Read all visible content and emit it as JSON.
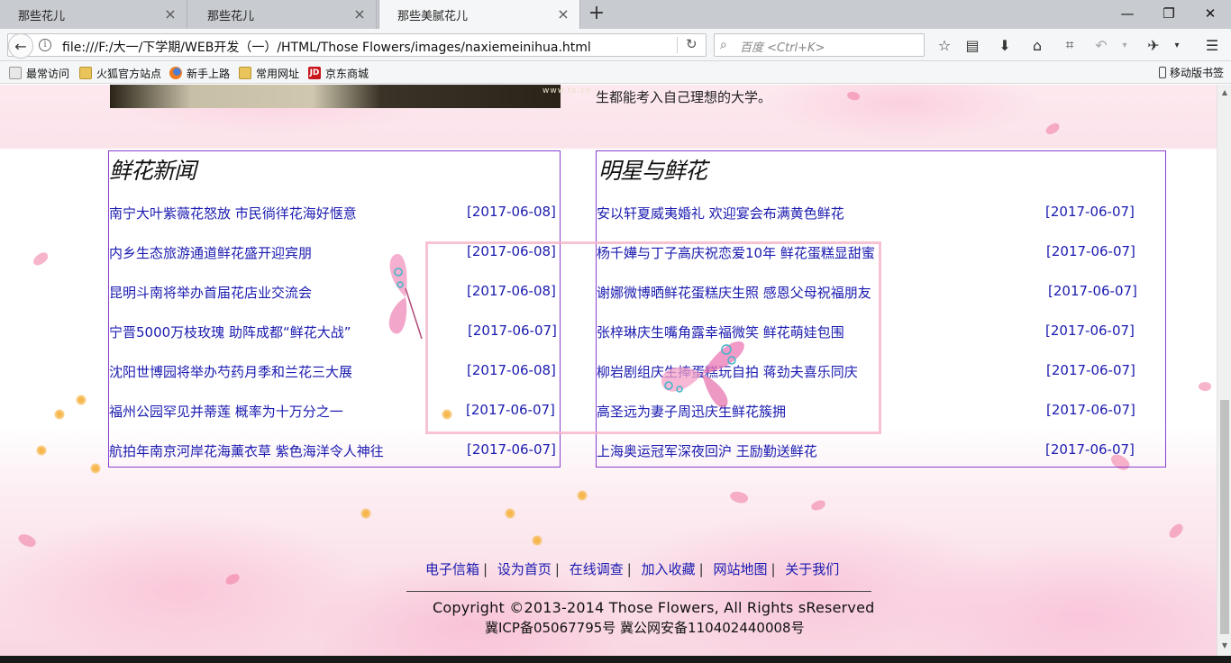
{
  "tabs": [
    {
      "label": "那些花儿",
      "active": false
    },
    {
      "label": "那些花儿",
      "active": false
    },
    {
      "label": "那些美腻花儿",
      "active": true
    }
  ],
  "toolbar": {
    "url": "file:///F:/大一/下学期/WEB开发（一）/HTML/Those Flowers/images/naxiemeinihua.html",
    "search_placeholder": "百度 <Ctrl+K>"
  },
  "bookmarks": [
    {
      "label": "最常访问",
      "icon": "gear-icon"
    },
    {
      "label": "火狐官方站点",
      "icon": "folder-icon"
    },
    {
      "label": "新手上路",
      "icon": "firefox-icon"
    },
    {
      "label": "常用网址",
      "icon": "folder-icon"
    },
    {
      "label": "京东商城",
      "icon": "jd-icon"
    }
  ],
  "mobile_bookmarks": "移动版书签",
  "page": {
    "top_image_watermark": "www.ts.cn",
    "top_text": "生都能考入自己理想的大学。",
    "left_box": {
      "title": "鲜花新闻",
      "items": [
        {
          "title": "南宁大叶紫薇花怒放  市民徜徉花海好惬意",
          "date": "[2017-06-08]"
        },
        {
          "title": "内乡生态旅游通道鲜花盛开迎宾朋",
          "date": "[2017-06-08]"
        },
        {
          "title": "昆明斗南将举办首届花店业交流会",
          "date": "[2017-06-08]"
        },
        {
          "title": "宁晋5000万枝玫瑰  助阵成都“鲜花大战”",
          "date": "[2017-06-07]"
        },
        {
          "title": "沈阳世博园将举办芍药月季和兰花三大展",
          "date": "[2017-06-08]"
        },
        {
          "title": "福州公园罕见并蒂莲  概率为十万分之一",
          "date": "[2017-06-07]"
        },
        {
          "title": "航拍年南京河岸花海薰衣草  紫色海洋令人神往",
          "date": "[2017-06-07]"
        }
      ]
    },
    "right_box": {
      "title": "明星与鲜花",
      "items": [
        {
          "title": "安以轩夏威夷婚礼  欢迎宴会布满黄色鲜花",
          "date": "[2017-06-07]"
        },
        {
          "title": "杨千嬅与丁子高庆祝恋爱10年  鲜花蛋糕显甜蜜",
          "date": "[2017-06-07]"
        },
        {
          "title": "谢娜微博晒鲜花蛋糕庆生照  感恩父母祝福朋友",
          "date": "[2017-06-07]"
        },
        {
          "title": "张梓琳庆生嘴角露幸福微笑  鲜花萌娃包围",
          "date": "[2017-06-07]"
        },
        {
          "title": "柳岩剧组庆生捧蛋糕玩自拍  蒋劲夫喜乐同庆",
          "date": "[2017-06-07]"
        },
        {
          "title": "高圣远为妻子周迅庆生鲜花簇拥",
          "date": "[2017-06-07]"
        },
        {
          "title": "上海奥运冠军深夜回沪  王励勤送鲜花",
          "date": "[2017-06-07]"
        }
      ]
    },
    "footer_links": [
      "电子信箱",
      "设为首页",
      "在线调查",
      "加入收藏",
      "网站地图",
      "关于我们"
    ],
    "copyright": "Copyright ©2013-2014  Those  Flowers, All  Rights sReserved",
    "icp": "冀ICP备05067795号  冀公网安备110402440008号"
  }
}
